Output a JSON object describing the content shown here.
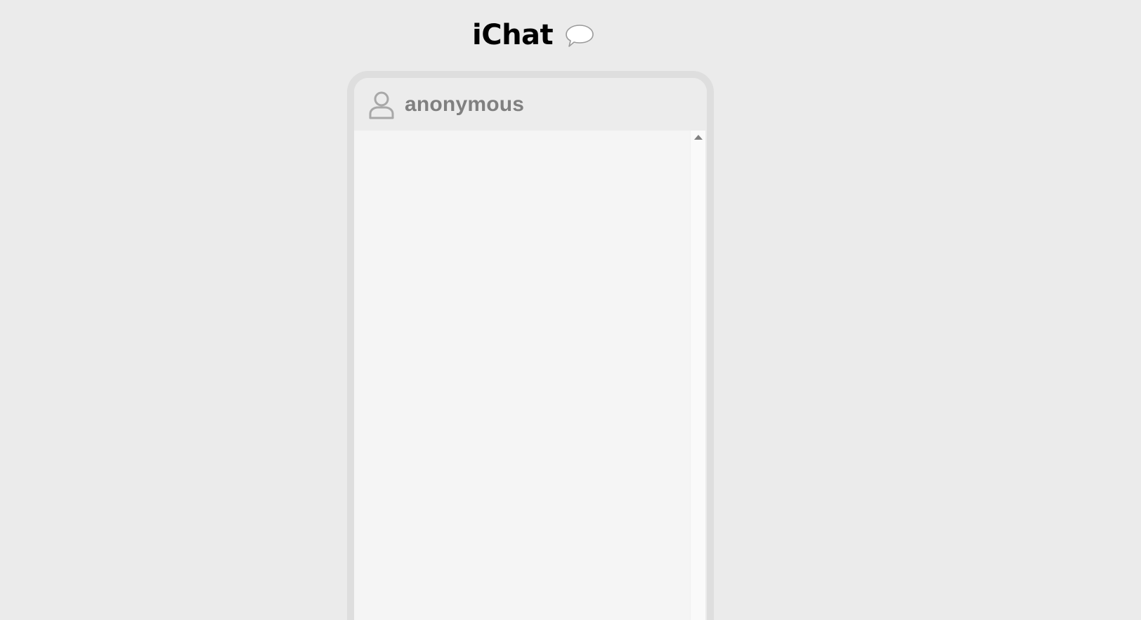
{
  "app": {
    "title": "iChat",
    "title_icon": "speech-bubble-icon"
  },
  "chat": {
    "header": {
      "avatar_icon": "user-icon",
      "username": "anonymous"
    },
    "messages": [],
    "scrollbar": {
      "up_arrow_icon": "scroll-up-arrow-icon"
    }
  },
  "colors": {
    "background": "#ebebeb",
    "frame": "#dedede",
    "header_bg": "#ececec",
    "messages_bg": "#f5f5f5",
    "username_text": "#808080",
    "title_text": "#000000"
  }
}
